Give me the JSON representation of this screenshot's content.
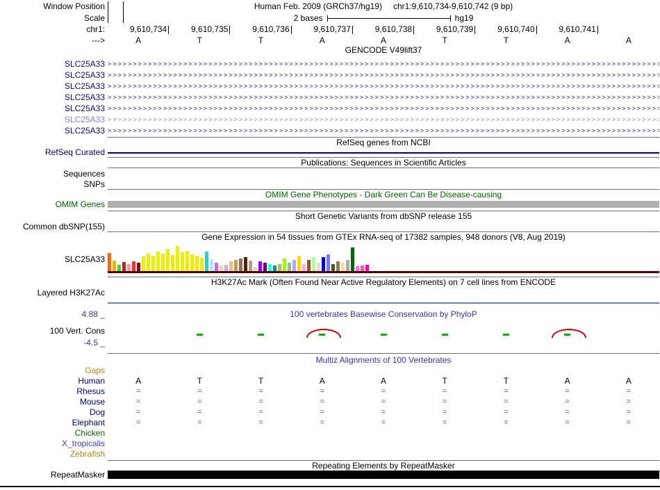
{
  "colors": {
    "gene_dark_blue": "#0C0C78",
    "gene_light_blue": "#8282D2",
    "refseq_navy": "#000080",
    "center_label_blue": "#3333BB",
    "omim_green": "#006400",
    "omim_bar_gray": "#B0B0B0",
    "gtex_baseline_maroon": "#550000",
    "h3k27ac_line_blue": "#6680C0",
    "phylop_green": "#00B400",
    "phylop_red": "#D40000",
    "alignment_gray": "#5A5A5A",
    "repeat_black": "#000000"
  },
  "header": {
    "window_position_label": "Window Position",
    "assembly": "Human Feb. 2009 (GRCh37/hg19)",
    "position": "chr1:9,610,734-9,610,742 (9 bp)",
    "scale_label": "Scale",
    "scale_length": "2 bases",
    "scale_assembly": "hg19",
    "chrom_label": "chr1:",
    "coordinates": [
      "9,610,734",
      "9,610,735",
      "9,610,736",
      "9,610,737",
      "9,610,738",
      "9,610,739",
      "9,610,740",
      "9,610,741"
    ],
    "strand_label": "--->",
    "bases": [
      "A",
      "T",
      "T",
      "A",
      "A",
      "T",
      "T",
      "A",
      "A"
    ]
  },
  "gencode": {
    "title": "GENCODE V49lift37",
    "arrow_char": ">",
    "transcripts": [
      {
        "label": "SLC25A33",
        "shade": "dark"
      },
      {
        "label": "SLC25A33",
        "shade": "dark"
      },
      {
        "label": "SLC25A33",
        "shade": "dark"
      },
      {
        "label": "SLC25A33",
        "shade": "dark"
      },
      {
        "label": "SLC25A33",
        "shade": "dark"
      },
      {
        "label": "SLC25A33",
        "shade": "light"
      },
      {
        "label": "SLC25A33",
        "shade": "dark"
      }
    ]
  },
  "refseq": {
    "title": "RefSeq genes from NCBI",
    "label": "RefSeq Curated"
  },
  "publications": {
    "title": "Publications: Sequences in Scientific Articles",
    "sequences_label": "Sequences",
    "snps_label": "SNPs"
  },
  "omim": {
    "title": "OMIM Gene Phenotypes - Dark Green Can Be Disease-causing",
    "label": "OMIM Genes"
  },
  "dbsnp": {
    "title": "Short Genetic Variants from dbSNP release 155",
    "label": "Common dbSNP(155)"
  },
  "gtex": {
    "title": "Gene Expression in 54 tissues from GTEx RNA-seq of 17382 samples, 948 donors (V8, Aug 2019)",
    "label": "SLC25A33",
    "bars": [
      {
        "h": 26,
        "c": "#FF6600"
      },
      {
        "h": 15,
        "c": "#FFAA00"
      },
      {
        "h": 9,
        "c": "#33DD33"
      },
      {
        "h": 13,
        "c": "#BB2222"
      },
      {
        "h": 10,
        "c": "#FF9999"
      },
      {
        "h": 14,
        "c": "#EE3333"
      },
      {
        "h": 12,
        "c": "#990000"
      },
      {
        "h": 21,
        "c": "#EEEE00"
      },
      {
        "h": 25,
        "c": "#EEEE00"
      },
      {
        "h": 22,
        "c": "#EEEE00"
      },
      {
        "h": 28,
        "c": "#EEEE00"
      },
      {
        "h": 25,
        "c": "#EEEE00"
      },
      {
        "h": 32,
        "c": "#EEEE00"
      },
      {
        "h": 23,
        "c": "#EEEE00"
      },
      {
        "h": 36,
        "c": "#EEEE00"
      },
      {
        "h": 27,
        "c": "#EEEE00"
      },
      {
        "h": 29,
        "c": "#EEEE00"
      },
      {
        "h": 24,
        "c": "#EEEE00"
      },
      {
        "h": 22,
        "c": "#EEEE00"
      },
      {
        "h": 19,
        "c": "#EEEE00"
      },
      {
        "h": 28,
        "c": "#33CCCC"
      },
      {
        "h": 17,
        "c": "#AAEEFF"
      },
      {
        "h": 12,
        "c": "#CC66FF"
      },
      {
        "h": 8,
        "c": "#FFCCCC"
      },
      {
        "h": 9,
        "c": "#CCAADD"
      },
      {
        "h": 14,
        "c": "#EEBB77"
      },
      {
        "h": 16,
        "c": "#CC9955"
      },
      {
        "h": 18,
        "c": "#8B7355"
      },
      {
        "h": 20,
        "c": "#552200"
      },
      {
        "h": 15,
        "c": "#BB9988"
      },
      {
        "h": 6,
        "c": "#FFCCCC"
      },
      {
        "h": 14,
        "c": "#9900FF"
      },
      {
        "h": 12,
        "c": "#660099"
      },
      {
        "h": 10,
        "c": "#22FFDD"
      },
      {
        "h": 8,
        "c": "#009988"
      },
      {
        "h": 10,
        "c": "#AABB66"
      },
      {
        "h": 18,
        "c": "#99FF00"
      },
      {
        "h": 12,
        "c": "#99BB88"
      },
      {
        "h": 16,
        "c": "#AAAAFF"
      },
      {
        "h": 22,
        "c": "#FFD700"
      },
      {
        "h": 10,
        "c": "#FFAAFF"
      },
      {
        "h": 16,
        "c": "#995522"
      },
      {
        "h": 20,
        "c": "#AAFF99"
      },
      {
        "h": 12,
        "c": "#DDDDDD"
      },
      {
        "h": 20,
        "c": "#0000FF"
      },
      {
        "h": 24,
        "c": "#7777FF"
      },
      {
        "h": 10,
        "c": "#555522"
      },
      {
        "h": 14,
        "c": "#778855"
      },
      {
        "h": 12,
        "c": "#FFDD99"
      },
      {
        "h": 16,
        "c": "#AAAAAA"
      },
      {
        "h": 34,
        "c": "#006600"
      },
      {
        "h": 7,
        "c": "#FF66FF"
      },
      {
        "h": 8,
        "c": "#FF5599"
      },
      {
        "h": 9,
        "c": "#FF00BB"
      }
    ]
  },
  "h3k27ac": {
    "title": "H3K27Ac Mark (Often Found Near Active Regulatory Elements) on 7 cell lines from ENCODE",
    "label": "Layered H3K27Ac"
  },
  "conservation": {
    "title": "100 vertebrates Basewise Conservation by PhyloP",
    "label": "100 Vert. Cons",
    "max_label": "4.88 _",
    "min_label": "-4.5 _",
    "green_cols": [
      1,
      2,
      3,
      4,
      5,
      6,
      7
    ],
    "red_arc_cols": [
      3,
      7
    ]
  },
  "multiz": {
    "title": "Multiz Alignments of 100 Vertebrates",
    "align_mark": "=",
    "rows": [
      {
        "name": "Gaps",
        "color": "#B8860B",
        "type": "empty"
      },
      {
        "name": "Human",
        "color": "#000080",
        "type": "bases"
      },
      {
        "name": "Rhesus",
        "color": "#000080",
        "type": "align"
      },
      {
        "name": "Mouse",
        "color": "#000080",
        "type": "align"
      },
      {
        "name": "Dog",
        "color": "#000080",
        "type": "align"
      },
      {
        "name": "Elephant",
        "color": "#000080",
        "type": "align"
      },
      {
        "name": "Chicken",
        "color": "#006400",
        "type": "empty"
      },
      {
        "name": "X_tropicalis",
        "color": "#3C3CC8",
        "type": "empty"
      },
      {
        "name": "Zebrafish",
        "color": "#B8860B",
        "type": "empty"
      }
    ]
  },
  "repeatmasker": {
    "title": "Repeating Elements by RepeatMasker",
    "label": "RepeatMasker"
  }
}
